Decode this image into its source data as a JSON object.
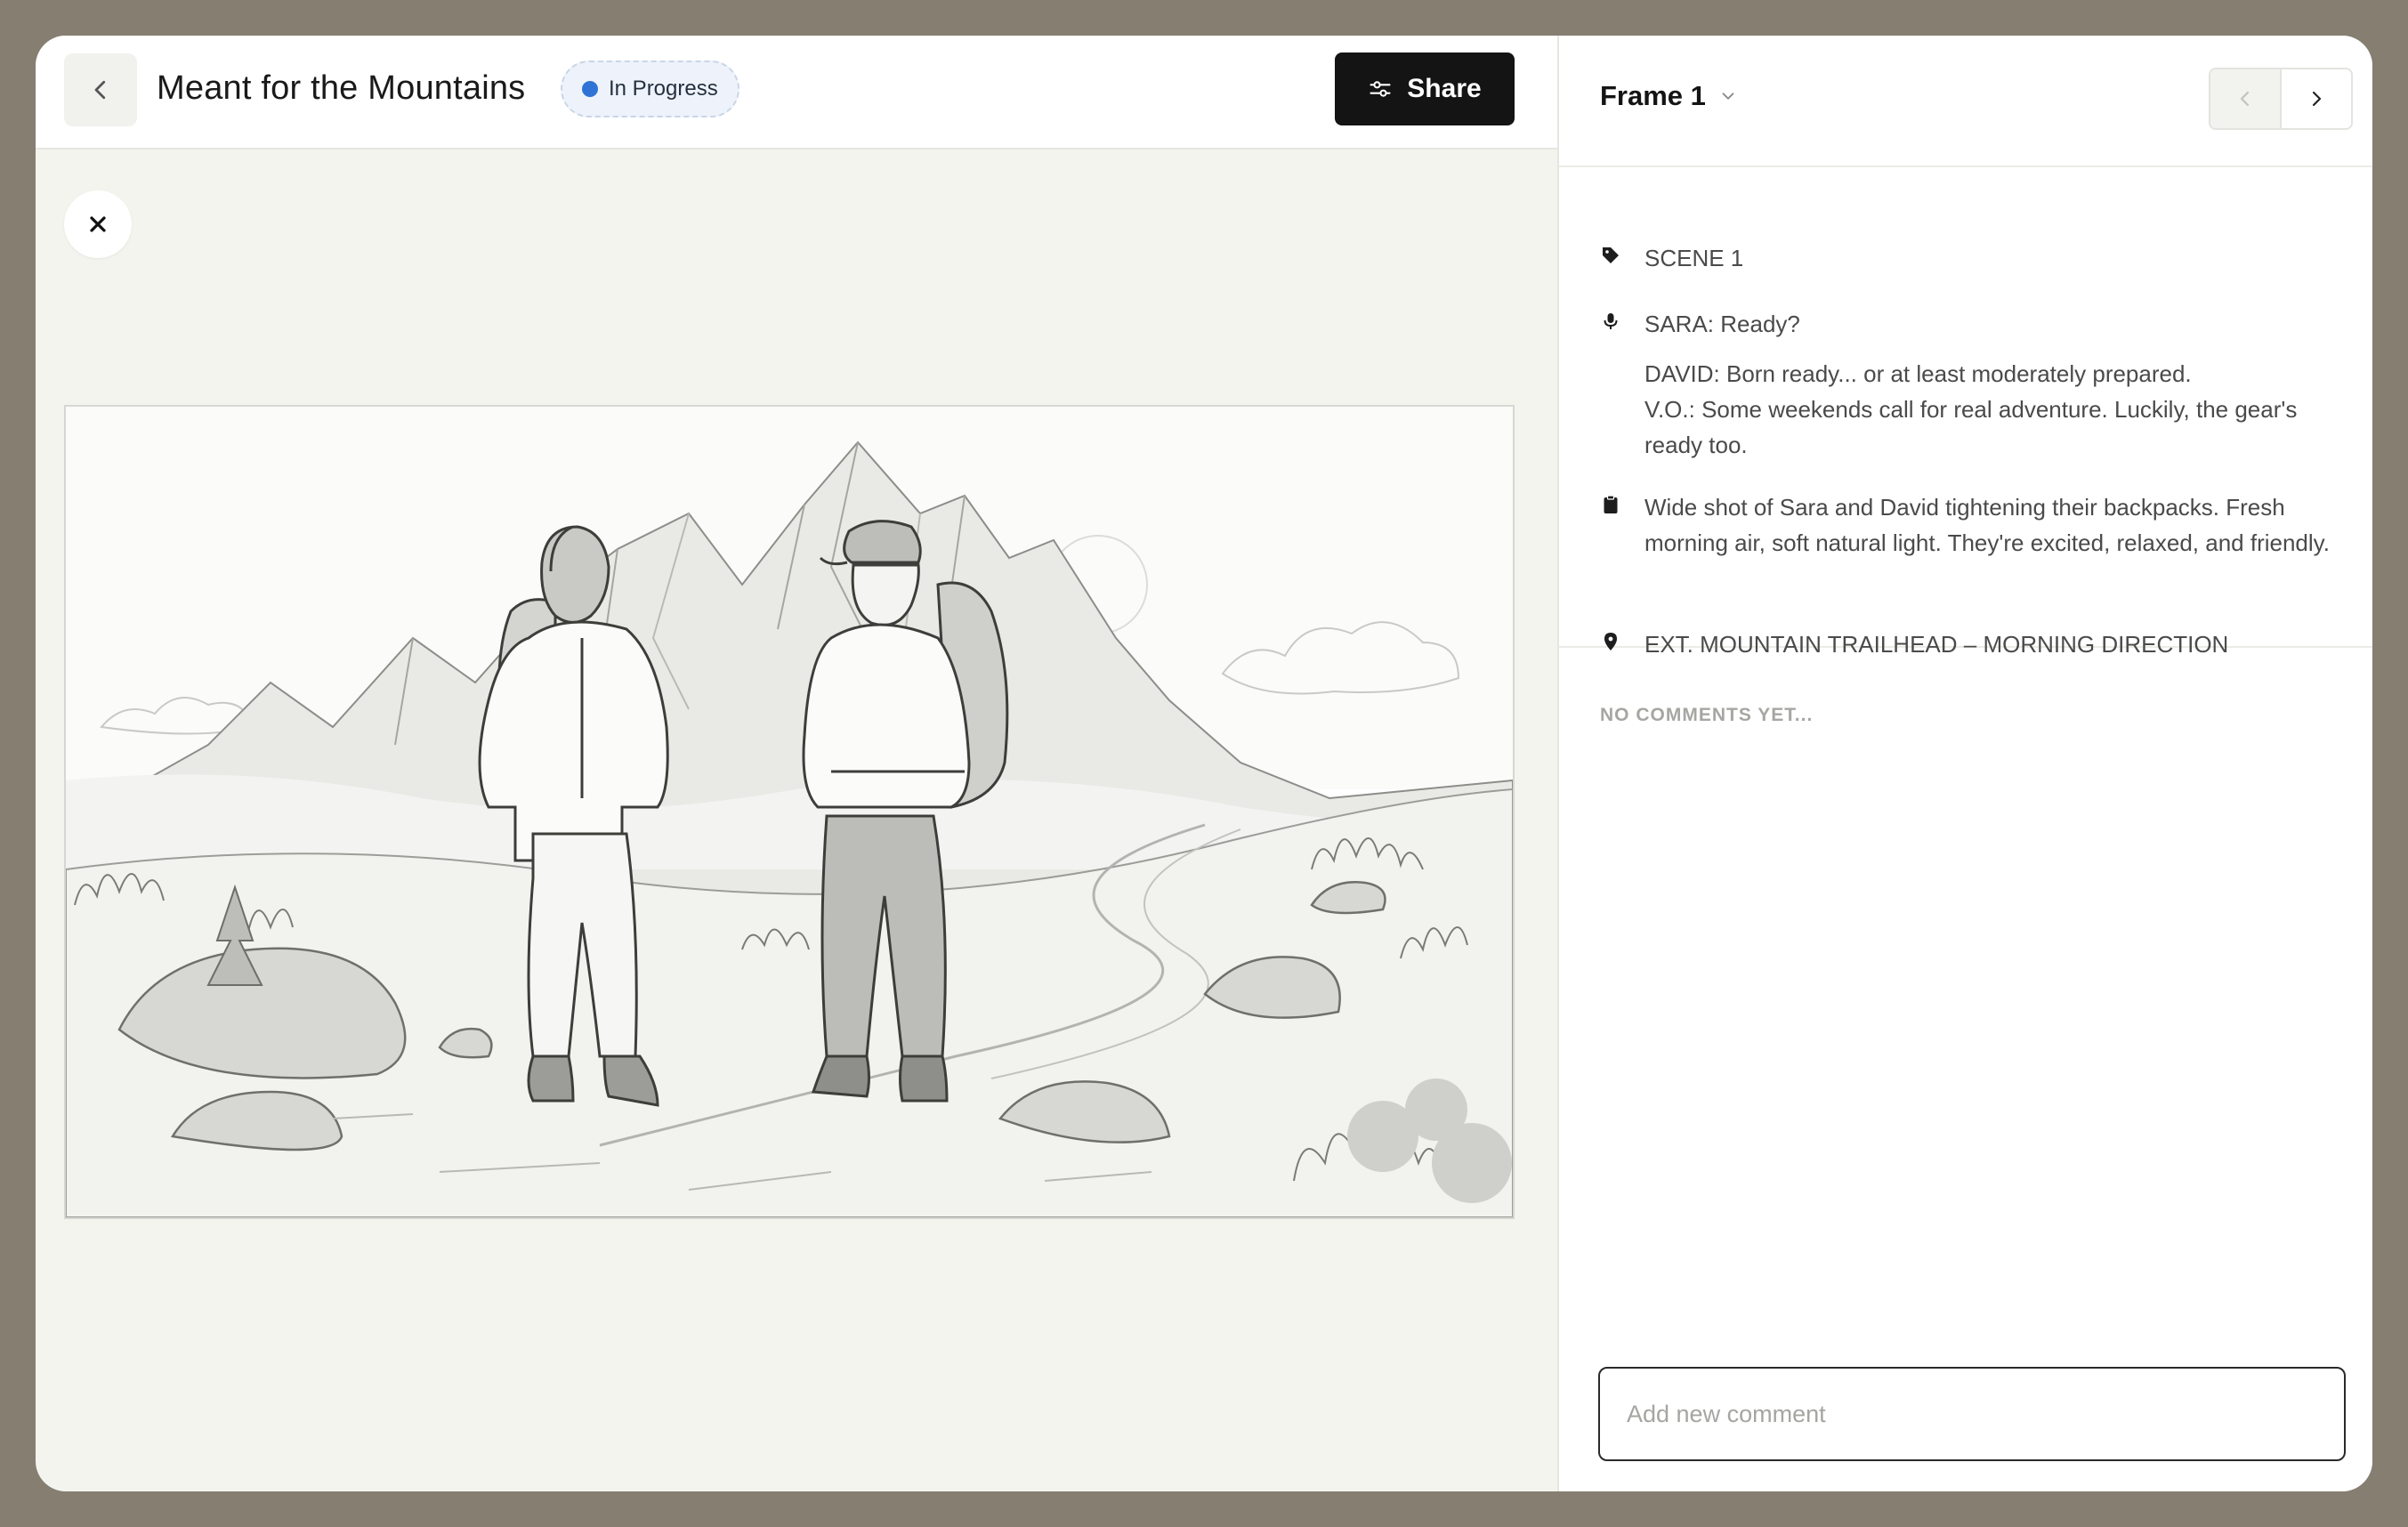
{
  "header": {
    "title": "Meant for the Mountains",
    "status": "In Progress",
    "share_label": "Share",
    "status_color": "#2f73d6"
  },
  "panel": {
    "frame_label": "Frame 1",
    "scene": "SCENE 1",
    "dialogue": [
      "SARA: Ready?",
      "DAVID: Born ready... or at least moderately prepared.",
      "V.O.: Some weekends call for real adventure. Luckily, the gear's ready too."
    ],
    "description": "Wide shot of Sara and David tightening their backpacks. Fresh morning air, soft natural light. They're excited, relaxed, and friendly.",
    "location": "EXT. MOUNTAIN TRAILHEAD – MORNING DIRECTION",
    "comments_empty": "NO COMMENTS YET...",
    "comment_placeholder": "Add new comment"
  },
  "icons": {
    "back": "chevron-left-icon",
    "share": "sliders-icon",
    "close": "close-icon",
    "frame_dropdown": "chevron-down-icon",
    "prev": "chevron-left-icon",
    "next": "chevron-right-icon",
    "scene": "tag-icon",
    "dialogue": "microphone-icon",
    "description": "clipboard-icon",
    "location": "map-pin-icon"
  }
}
